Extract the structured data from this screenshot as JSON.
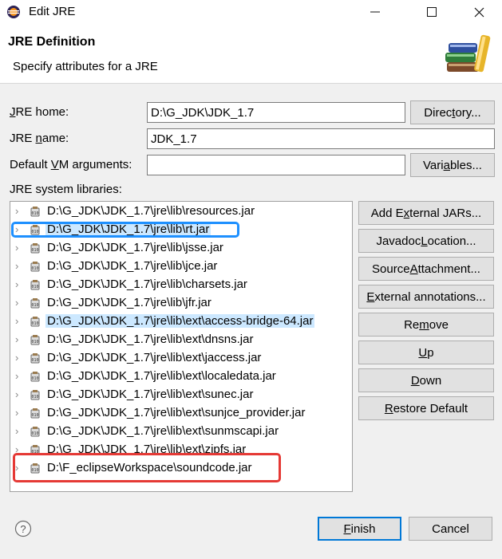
{
  "window": {
    "title": "Edit JRE",
    "minimize": "—",
    "maximize": "☐",
    "close": "✕"
  },
  "header": {
    "title": "JRE Definition",
    "description": "Specify attributes for a JRE"
  },
  "form": {
    "jre_home_label_pre": "",
    "jre_home_label_u": "J",
    "jre_home_label_post": "RE home:",
    "jre_home_value": "D:\\G_JDK\\JDK_1.7",
    "directory_pre": "Direc",
    "directory_u": "t",
    "directory_post": "ory...",
    "jre_name_label_pre": "JRE ",
    "jre_name_label_u": "n",
    "jre_name_label_post": "ame:",
    "jre_name_value": "JDK_1.7",
    "vm_args_label_pre": "Default ",
    "vm_args_label_u": "V",
    "vm_args_label_post": "M arguments:",
    "vm_args_value": "",
    "variables_pre": "Vari",
    "variables_u": "a",
    "variables_post": "bles...",
    "libs_label": "JRE system libraries:"
  },
  "libraries": [
    "D:\\G_JDK\\JDK_1.7\\jre\\lib\\resources.jar",
    "D:\\G_JDK\\JDK_1.7\\jre\\lib\\rt.jar",
    "D:\\G_JDK\\JDK_1.7\\jre\\lib\\jsse.jar",
    "D:\\G_JDK\\JDK_1.7\\jre\\lib\\jce.jar",
    "D:\\G_JDK\\JDK_1.7\\jre\\lib\\charsets.jar",
    "D:\\G_JDK\\JDK_1.7\\jre\\lib\\jfr.jar",
    "D:\\G_JDK\\JDK_1.7\\jre\\lib\\ext\\access-bridge-64.jar",
    "D:\\G_JDK\\JDK_1.7\\jre\\lib\\ext\\dnsns.jar",
    "D:\\G_JDK\\JDK_1.7\\jre\\lib\\ext\\jaccess.jar",
    "D:\\G_JDK\\JDK_1.7\\jre\\lib\\ext\\localedata.jar",
    "D:\\G_JDK\\JDK_1.7\\jre\\lib\\ext\\sunec.jar",
    "D:\\G_JDK\\JDK_1.7\\jre\\lib\\ext\\sunjce_provider.jar",
    "D:\\G_JDK\\JDK_1.7\\jre\\lib\\ext\\sunmscapi.jar",
    "D:\\G_JDK\\JDK_1.7\\jre\\lib\\ext\\zipfs.jar",
    "D:\\F_eclipseWorkspace\\soundcode.jar"
  ],
  "side_buttons": {
    "add_ext_pre": "Add E",
    "add_ext_u": "x",
    "add_ext_post": "ternal JARs...",
    "javadoc_pre": "Javadoc ",
    "javadoc_u": "L",
    "javadoc_post": "ocation...",
    "source_pre": "Source ",
    "source_u": "A",
    "source_post": "ttachment...",
    "ext_ann_pre": "",
    "ext_ann_u": "E",
    "ext_ann_post": "xternal annotations...",
    "remove_pre": "Re",
    "remove_u": "m",
    "remove_post": "ove",
    "up_pre": "",
    "up_u": "U",
    "up_post": "p",
    "down_pre": "",
    "down_u": "D",
    "down_post": "own",
    "restore_pre": "",
    "restore_u": "R",
    "restore_post": "estore Default"
  },
  "footer": {
    "help_icon": "?",
    "finish_pre": "",
    "finish_u": "F",
    "finish_post": "inish",
    "cancel": "Cancel"
  },
  "colors": {
    "selection": "#cce8ff",
    "highlight_blue": "#1e90ff",
    "highlight_red": "#e53935",
    "default_button_border": "#0078d7"
  }
}
